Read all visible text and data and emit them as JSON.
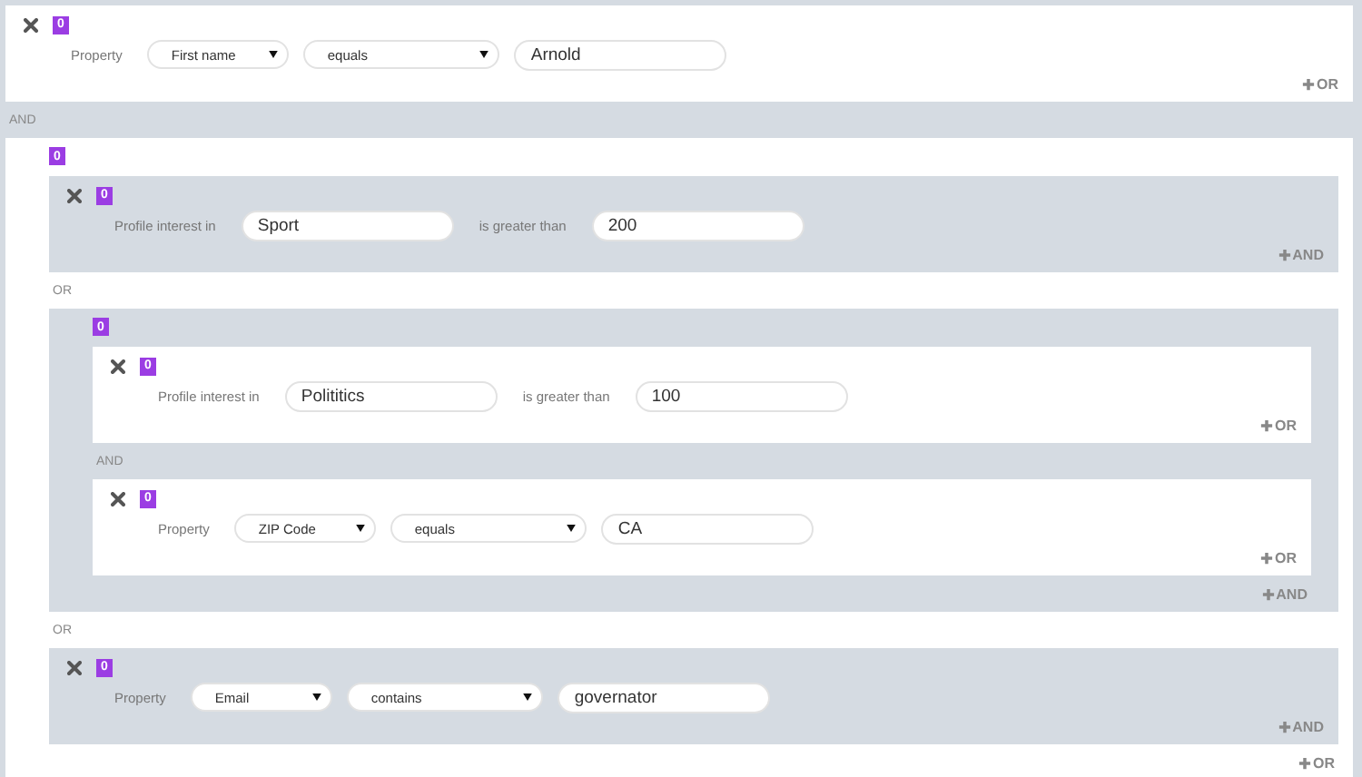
{
  "root": {
    "kind": "group",
    "joiners": [
      "AND"
    ],
    "children": [
      {
        "kind": "rule",
        "badge": "0",
        "add": "OR",
        "parts": [
          {
            "kind": "label",
            "text": "Property"
          },
          {
            "kind": "select",
            "text": "First name"
          },
          {
            "kind": "select",
            "text": "equals"
          },
          {
            "kind": "input",
            "text": "Arnold"
          }
        ]
      },
      {
        "kind": "group",
        "badge": "0",
        "joiners": [
          "OR",
          "OR"
        ],
        "add": "OR",
        "children": [
          {
            "kind": "rule",
            "badge": "0",
            "add": "AND",
            "parts": [
              {
                "kind": "label",
                "text": "Profile interest in"
              },
              {
                "kind": "input",
                "text": "Sport"
              },
              {
                "kind": "label",
                "text": "is greater than"
              },
              {
                "kind": "input",
                "text": "200"
              }
            ]
          },
          {
            "kind": "group",
            "badge": "0",
            "joiners": [
              "AND"
            ],
            "add": "AND",
            "children": [
              {
                "kind": "rule",
                "badge": "0",
                "add": "OR",
                "parts": [
                  {
                    "kind": "label",
                    "text": "Profile interest in"
                  },
                  {
                    "kind": "input",
                    "text": "Polititics"
                  },
                  {
                    "kind": "label",
                    "text": "is greater than"
                  },
                  {
                    "kind": "input",
                    "text": "100"
                  }
                ]
              },
              {
                "kind": "rule",
                "badge": "0",
                "add": "OR",
                "parts": [
                  {
                    "kind": "label",
                    "text": "Property"
                  },
                  {
                    "kind": "select",
                    "text": "ZIP Code"
                  },
                  {
                    "kind": "select",
                    "text": "equals"
                  },
                  {
                    "kind": "input",
                    "text": "CA"
                  }
                ]
              }
            ]
          },
          {
            "kind": "rule",
            "badge": "0",
            "add": "AND",
            "parts": [
              {
                "kind": "label",
                "text": "Property"
              },
              {
                "kind": "select",
                "text": "Email"
              },
              {
                "kind": "select",
                "text": "contains"
              },
              {
                "kind": "input",
                "text": "governator"
              }
            ]
          }
        ]
      }
    ]
  }
}
